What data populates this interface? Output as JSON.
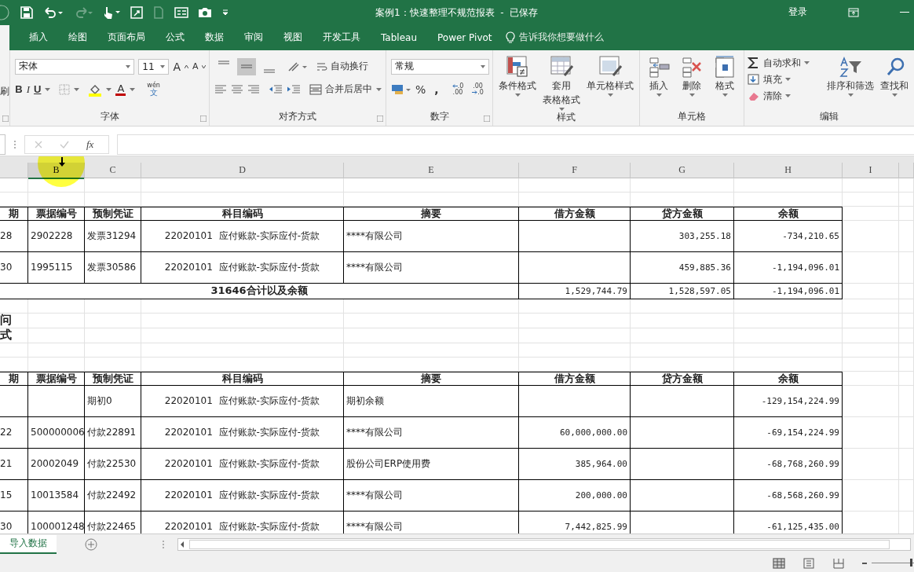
{
  "title_bar": {
    "title": "案例1：快速整理不规范报表  -  已保存",
    "sign_in": "登录",
    "redo_disabled": true
  },
  "ribbon_tabs": [
    {
      "label": "插入",
      "selected": false
    },
    {
      "label": "绘图",
      "selected": false
    },
    {
      "label": "页面布局",
      "selected": false
    },
    {
      "label": "公式",
      "selected": false
    },
    {
      "label": "数据",
      "selected": false
    },
    {
      "label": "审阅",
      "selected": false
    },
    {
      "label": "视图",
      "selected": false
    },
    {
      "label": "开发工具",
      "selected": false
    },
    {
      "label": "Tableau",
      "selected": false
    },
    {
      "label": "Power Pivot",
      "selected": false
    }
  ],
  "tell_me": {
    "placeholder": "告诉我你想要做什么"
  },
  "ribbon": {
    "clipboard": {
      "fragment": "刷"
    },
    "font": {
      "font_name": "宋体",
      "font_size": "11",
      "grow": "A",
      "shrink": "A",
      "bold": "B",
      "italic": "I",
      "underline": "U",
      "font_color": "A",
      "phonetic": "wén",
      "phonetic_base": "文",
      "label": "字体"
    },
    "alignment": {
      "vertical": [
        {
          "selected": false
        },
        {
          "selected": true
        },
        {
          "selected": false
        }
      ],
      "wrap_text": "自动换行",
      "merge": "合并后居中",
      "label": "对齐方式"
    },
    "number": {
      "format": "常规",
      "percent": "%",
      "comma": ",",
      "increase_decimal": [
        ".0",
        ".00"
      ],
      "decrease_decimal": [
        ".00",
        ".0"
      ],
      "label": "数字"
    },
    "styles": {
      "buttons": [
        {
          "lines": [
            "条件格式"
          ]
        },
        {
          "lines": [
            "套用",
            "表格格式"
          ]
        },
        {
          "lines": [
            "单元格样式"
          ]
        }
      ],
      "label": "样式"
    },
    "cells": {
      "buttons": [
        "插入",
        "删除",
        "格式"
      ],
      "label": "单元格"
    },
    "editing": {
      "items": [
        "自动求和",
        "填充",
        "清除"
      ],
      "buttons": [
        "排序和筛选",
        "查找和"
      ],
      "label": "编辑"
    }
  },
  "formula_bar": {
    "function_label": "fx"
  },
  "columns": [
    {
      "label": "B",
      "selected": true
    },
    {
      "label": "C",
      "selected": false
    },
    {
      "label": "D",
      "selected": false
    },
    {
      "label": "E",
      "selected": false
    },
    {
      "label": "F",
      "selected": false
    },
    {
      "label": "G",
      "selected": false
    },
    {
      "label": "H",
      "selected": false
    },
    {
      "label": "I",
      "selected": false
    }
  ],
  "rows": [
    {
      "kind": "blank"
    },
    {
      "kind": "blank"
    },
    {
      "kind": "header",
      "cells": [
        "期",
        "票据编号",
        "预制凭证",
        "科目编码",
        "摘要",
        "借方金额",
        "贷方金额",
        "余额"
      ]
    },
    {
      "kind": "data",
      "cells": [
        "28",
        "2902228",
        "发票31294",
        "22020101  应付账款-实际应付-货款",
        "****有限公司",
        null,
        "303,255.18",
        "-734,210.65"
      ]
    },
    {
      "kind": "data",
      "cells": [
        "30",
        "1995115",
        "发票30586",
        "22020101  应付账款-实际应付-货款",
        "****有限公司",
        null,
        "459,885.36",
        "-1,194,096.01"
      ]
    },
    {
      "kind": "total",
      "label": "31646合计以及余额",
      "cells": [
        "1,529,744.79",
        "1,528,597.05",
        "-1,194,096.01"
      ]
    },
    {
      "kind": "blank"
    },
    {
      "kind": "note",
      "text": "问"
    },
    {
      "kind": "note",
      "text": "式"
    },
    {
      "kind": "blank"
    },
    {
      "kind": "blank"
    },
    {
      "kind": "header",
      "cells": [
        "期",
        "票据编号",
        "预制凭证",
        "科目编码",
        "摘要",
        "借方金额",
        "贷方金额",
        "余额"
      ]
    },
    {
      "kind": "data",
      "cells": [
        null,
        null,
        "期初0",
        "22020101  应付账款-实际应付-货款",
        "期初余额",
        null,
        null,
        "-129,154,224.99"
      ]
    },
    {
      "kind": "data",
      "cells": [
        "22",
        "500000006",
        "付款22891",
        "22020101  应付账款-实际应付-货款",
        "****有限公司",
        "60,000,000.00",
        null,
        "-69,154,224.99"
      ]
    },
    {
      "kind": "data",
      "cells": [
        "21",
        "20002049",
        "付款22530",
        "22020101  应付账款-实际应付-货款",
        "股份公司ERP使用费",
        "385,964.00",
        null,
        "-68,768,260.99"
      ]
    },
    {
      "kind": "data",
      "cells": [
        "15",
        "10013584",
        "付款22492",
        "22020101  应付账款-实际应付-货款",
        "****有限公司",
        "200,000.00",
        null,
        "-68,568,260.99"
      ]
    },
    {
      "kind": "data",
      "cells": [
        "30",
        "100001248",
        "付款22465",
        "22020101  应付账款-实际应付-货款",
        "****有限公司",
        "7,442,825.99",
        null,
        "-61,125,435.00"
      ]
    }
  ],
  "sheet_tabs": [
    {
      "label": "导入数据",
      "selected": true
    }
  ],
  "zoom": {
    "level": 0.95
  }
}
